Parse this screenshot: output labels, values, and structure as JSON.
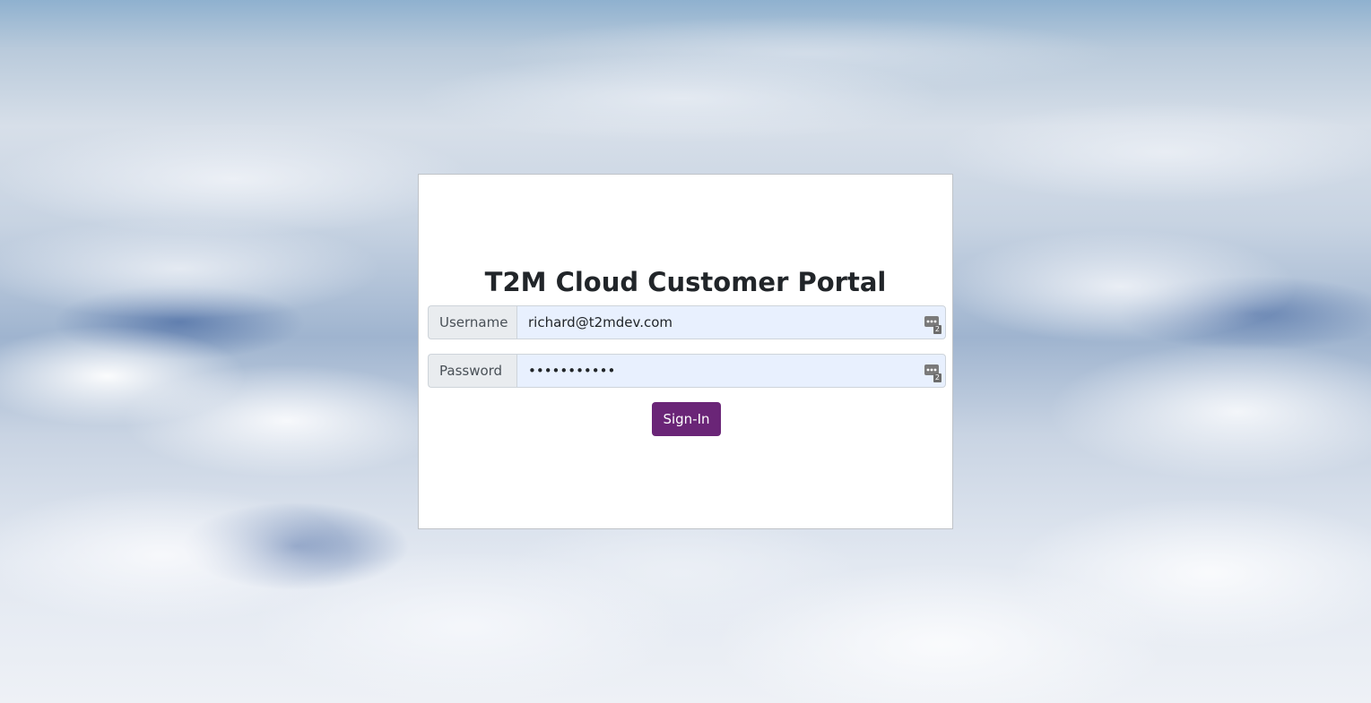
{
  "page": {
    "title": "T2M Cloud Customer Portal"
  },
  "form": {
    "username": {
      "label": "Username",
      "value": "richard@t2mdev.com",
      "password_manager_count": "2"
    },
    "password": {
      "label": "Password",
      "value": "•••••••••••",
      "password_manager_count": "2"
    },
    "submit_label": "Sign-In"
  },
  "colors": {
    "button_bg": "#6a2577",
    "autofill_bg": "#e8f0fe",
    "addon_bg": "#e9ecef"
  }
}
